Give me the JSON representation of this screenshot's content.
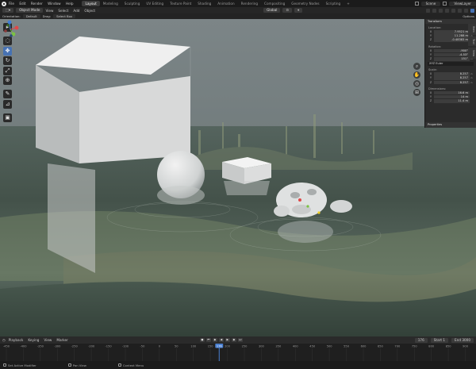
{
  "topbar": {
    "menu": [
      "File",
      "Edit",
      "Render",
      "Window",
      "Help"
    ],
    "workspaces": [
      "Layout",
      "Modeling",
      "Sculpting",
      "UV Editing",
      "Texture Paint",
      "Shading",
      "Animation",
      "Rendering",
      "Compositing",
      "Geometry Nodes",
      "Scripting",
      "+"
    ],
    "active_workspace": "Layout",
    "scene": "Scene",
    "view_layer": "ViewLayer"
  },
  "header": {
    "mode": "Object Mode",
    "menus": [
      "View",
      "Select",
      "Add",
      "Object"
    ],
    "transform_orientation": "Global"
  },
  "subheader": {
    "orientation_label": "Orientation:",
    "orientation_value": "Default",
    "drag_label": "Drag:",
    "drag_value": "Select Box",
    "options_label": "Options"
  },
  "toolbar": [
    "cursor-icon",
    "select-box-icon",
    "move-icon",
    "rotate-icon",
    "scale-icon",
    "transform-icon",
    "annotate-icon",
    "measure-icon",
    "add-cube-icon"
  ],
  "npanel": {
    "title": "Transform",
    "location_label": "Location:",
    "location": [
      {
        "axis": "X",
        "value": "7.9521 m"
      },
      {
        "axis": "Y",
        "value": "11.288 m"
      },
      {
        "axis": "Z",
        "value": "-0.48383 m"
      }
    ],
    "rotation_label": "Rotation:",
    "rotation": [
      {
        "axis": "X",
        "value": "-900°"
      },
      {
        "axis": "Y",
        "value": "-4.53°"
      },
      {
        "axis": "Z",
        "value": "151°"
      }
    ],
    "rotation_mode": "XYZ Euler",
    "scale_label": "Scale:",
    "scale": [
      {
        "axis": "X",
        "value": "8.257"
      },
      {
        "axis": "Y",
        "value": "8.257"
      },
      {
        "axis": "Z",
        "value": "8.257"
      }
    ],
    "dimensions_label": "Dimensions:",
    "dimensions": [
      {
        "axis": "X",
        "value": "16.6 m"
      },
      {
        "axis": "Y",
        "value": "14 m"
      },
      {
        "axis": "Z",
        "value": "11.4 m"
      }
    ],
    "properties_label": "Properties",
    "tabs": [
      "Item",
      "Tool",
      "View"
    ]
  },
  "timeline_header": {
    "menus": [
      "Playback",
      "Keying",
      "View",
      "Marker"
    ],
    "current_frame": "176",
    "start_label": "Start",
    "start_value": "1",
    "end_label": "End",
    "end_value": "3000"
  },
  "timeline": {
    "ticks": [
      "-450",
      "-400",
      "-350",
      "-300",
      "-250",
      "-200",
      "-150",
      "-100",
      "-50",
      "0",
      "50",
      "100",
      "150",
      "200",
      "250",
      "300",
      "350",
      "400",
      "450",
      "500",
      "550",
      "600",
      "650",
      "700",
      "750",
      "800",
      "850",
      "900"
    ],
    "current": "176"
  },
  "statusbar": {
    "items": [
      "Set Active Modifier",
      "Pan View",
      "Context Menu"
    ]
  },
  "colors": {
    "accent": "#4772b3",
    "playhead": "#4a7fd0",
    "axis_x": "#e04848",
    "axis_y": "#7bc243",
    "axis_z": "#3f7ed6"
  }
}
